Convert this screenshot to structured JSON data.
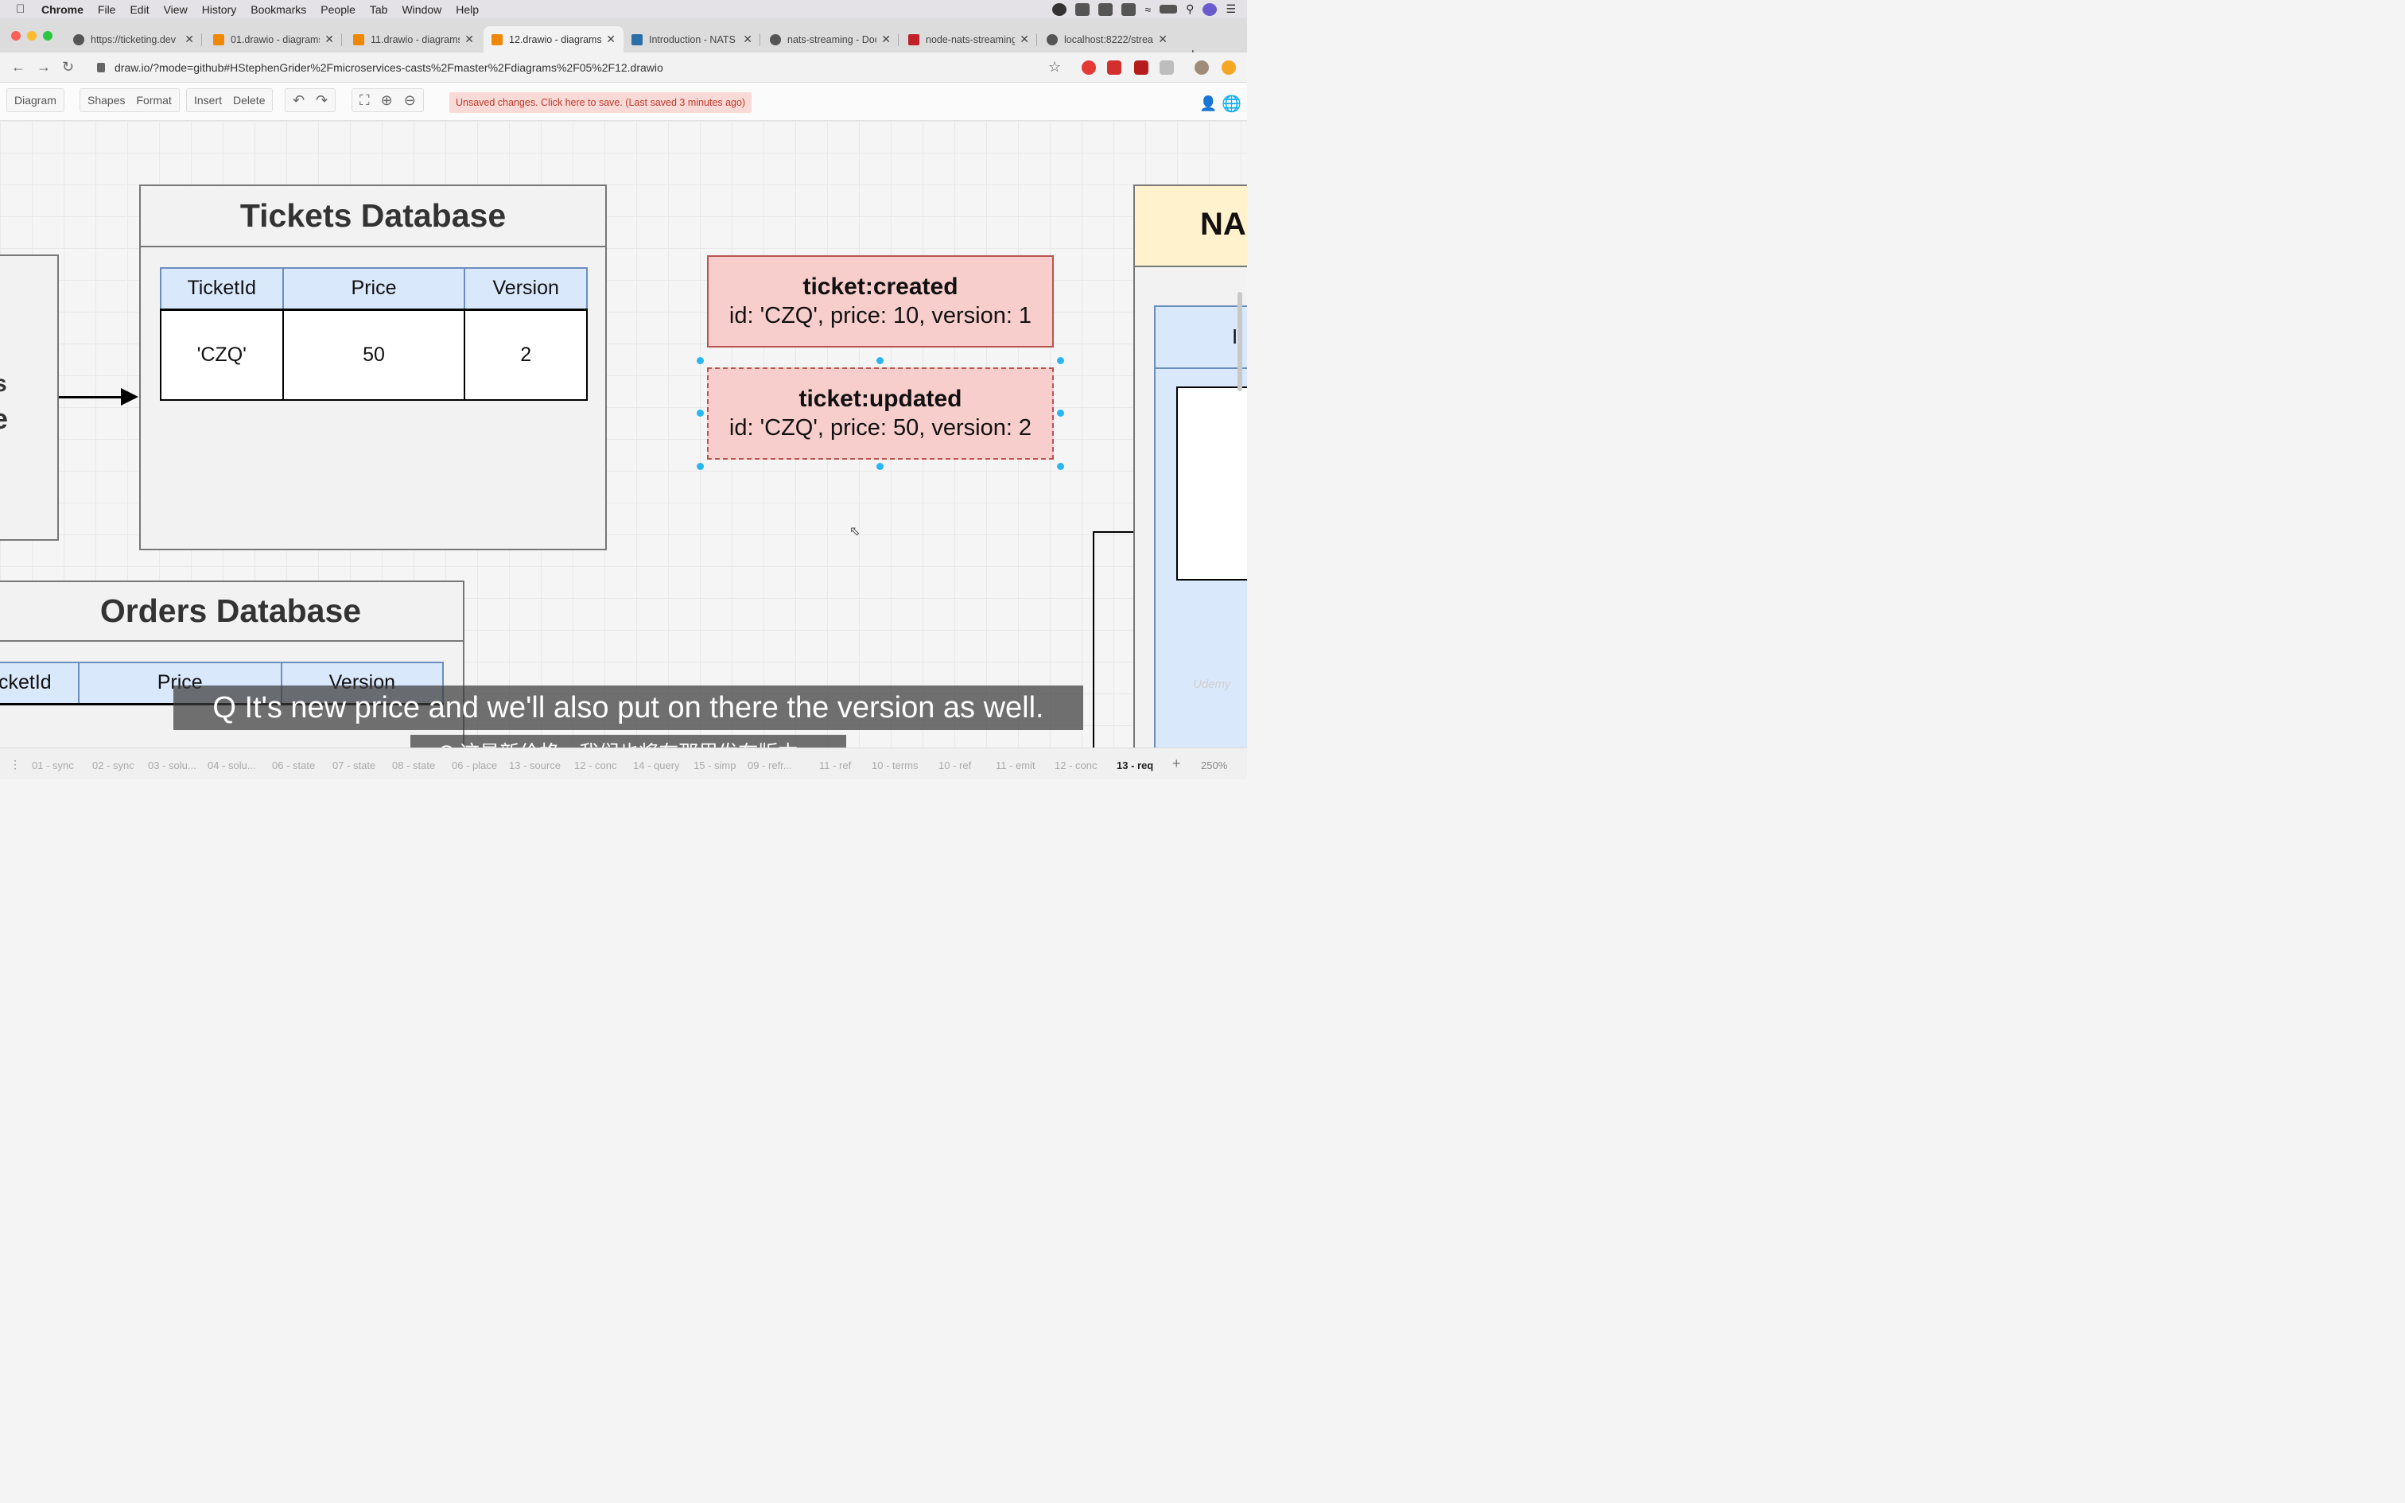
{
  "menubar": {
    "app": "Chrome",
    "items": [
      "File",
      "Edit",
      "View",
      "History",
      "Bookmarks",
      "People",
      "Tab",
      "Window",
      "Help"
    ]
  },
  "tabs": [
    {
      "label": "https://ticketing.dev",
      "favicon": "globe-icon"
    },
    {
      "label": "01.drawio - diagrams.net",
      "favicon": "drawio-icon"
    },
    {
      "label": "11.drawio - diagrams.net",
      "favicon": "drawio-icon"
    },
    {
      "label": "12.drawio - diagrams.net",
      "favicon": "drawio-icon",
      "active": true
    },
    {
      "label": "Introduction - NATS",
      "favicon": "nats-icon"
    },
    {
      "label": "nats-streaming - Docker",
      "favicon": "docker-icon"
    },
    {
      "label": "node-nats-streaming",
      "favicon": "npm-icon"
    },
    {
      "label": "localhost:8222/streaming",
      "favicon": "globe-icon"
    }
  ],
  "address": {
    "url": "draw.io/?mode=github#HStephenGrider%2Fmicroservices-casts%2Fmaster%2Fdiagrams%2F05%2F12.drawio"
  },
  "drawio_toolbar": {
    "diagram": "Diagram",
    "shapes": "Shapes",
    "format": "Format",
    "insert": "Insert",
    "delete": "Delete",
    "unsaved": "Unsaved changes. Click here to save. (Last saved 3 minutes ago)"
  },
  "canvas": {
    "tickets_db": {
      "title": "Tickets Database",
      "headers": [
        "TicketId",
        "Price",
        "Version"
      ],
      "row": [
        "'CZQ'",
        "50",
        "2"
      ]
    },
    "orders_db": {
      "title": "Orders Database",
      "headers": [
        "cketId",
        "Price",
        "Version"
      ]
    },
    "events": [
      {
        "title": "ticket:created",
        "body": "id: 'CZQ', price: 10, version: 1"
      },
      {
        "title": "ticket:updated",
        "body": "id: 'CZQ', price: 50, version: 2"
      }
    ],
    "left_box_text": [
      "s",
      "e"
    ],
    "nats_title": "NA",
    "nats_inner_text": "I"
  },
  "subtitles": {
    "en": "Q It's new price and we'll also put on there the version as well.",
    "zh": "Q 这是新价格，我们也将在那里发布版本。"
  },
  "pages": [
    {
      "label": "01 - sync"
    },
    {
      "label": "02 - sync"
    },
    {
      "label": "03 - solu..."
    },
    {
      "label": "04 - solu..."
    },
    {
      "label": "06 - state"
    },
    {
      "label": "07 - state"
    },
    {
      "label": "08 - state"
    },
    {
      "label": "06 - place"
    },
    {
      "label": "13 - source"
    },
    {
      "label": "12 - conc"
    },
    {
      "label": "14 - query"
    },
    {
      "label": "15 - simp"
    },
    {
      "label": "09 - refr..."
    },
    {
      "label": "11 - ref"
    },
    {
      "label": "10 - terms"
    },
    {
      "label": "10 - ref"
    },
    {
      "label": "11 - emit"
    },
    {
      "label": "12 - conc"
    },
    {
      "label": "13 - req",
      "active": true
    }
  ],
  "zoom": "250%",
  "watermark": "Udemy",
  "colors": {
    "table_header": "#dae8fc",
    "event_fill": "#f8cecc",
    "event_border": "#b85450",
    "nats_header": "#fff2cc",
    "selection_handle": "#29b6f2"
  }
}
